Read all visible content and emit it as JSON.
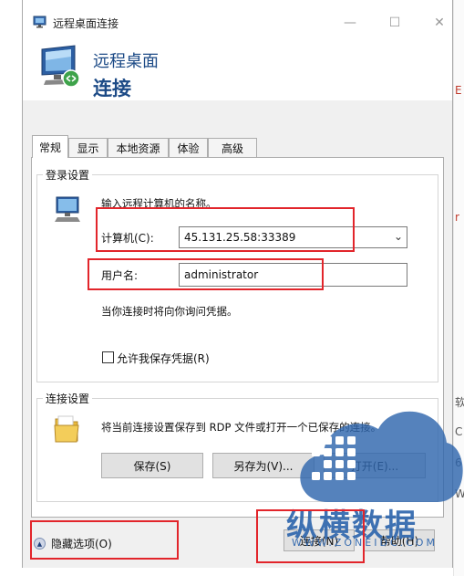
{
  "window": {
    "title": "远程桌面连接",
    "header_line1": "远程桌面",
    "header_line2": "连接"
  },
  "tabs": [
    "常规",
    "显示",
    "本地资源",
    "体验",
    "高级"
  ],
  "login_group": {
    "title": "登录设置",
    "instruction": "输入远程计算机的名称。",
    "computer_label": "计算机(C):",
    "computer_value": "45.131.25.58:33389",
    "username_label": "用户名:",
    "username_value": "administrator",
    "prompt_text": "当你连接时将向你询问凭据。",
    "save_credentials_label": "允许我保存凭据(R)"
  },
  "connect_group": {
    "title": "连接设置",
    "description": "将当前连接设置保存到 RDP 文件或打开一个已保存的连接。",
    "save_button": "保存(S)",
    "save_as_button": "另存为(V)...",
    "open_button": "打开(E)..."
  },
  "footer": {
    "hide_options": "隐藏选项(O)",
    "connect_button": "连接(N)",
    "help_button": "帮助(H)"
  },
  "watermark": {
    "brand": "纵横数据",
    "domain": "WWW.ZONEIDC.COM"
  },
  "background_chars": [
    "E",
    "r",
    "软",
    "C",
    "6",
    "W"
  ],
  "colors": {
    "header_blue": "#1c4a86",
    "annotation_red": "#e2252b",
    "watermark_blue": "#2f66ad"
  }
}
